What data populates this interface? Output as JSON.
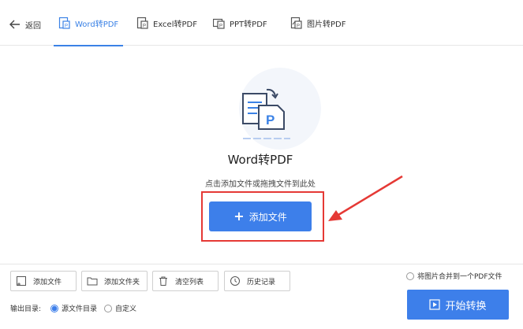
{
  "header": {
    "back_label": "返回",
    "tabs": [
      {
        "label": "Word转PDF",
        "active": true,
        "icon": "word-to-pdf-icon"
      },
      {
        "label": "Excel转PDF",
        "active": false,
        "icon": "excel-to-pdf-icon"
      },
      {
        "label": "PPT转PDF",
        "active": false,
        "icon": "ppt-to-pdf-icon"
      },
      {
        "label": "图片转PDF",
        "active": false,
        "icon": "image-to-pdf-icon"
      }
    ]
  },
  "main": {
    "title": "Word转PDF",
    "hint": "点击添加文件或拖拽文件到此处",
    "add_button": "添加文件"
  },
  "toolbar": {
    "add_file": "添加文件",
    "add_folder": "添加文件夹",
    "clear_list": "清空列表",
    "history": "历史记录"
  },
  "options": {
    "merge_label": "将图片合并到一个PDF文件",
    "merge_checked": false,
    "output_label": "输出目录:",
    "source_dir": "源文件目录",
    "custom": "自定义",
    "selected": "source_dir"
  },
  "start_button": "开始转换",
  "colors": {
    "accent": "#3d7fea",
    "annotation": "#e53935"
  }
}
